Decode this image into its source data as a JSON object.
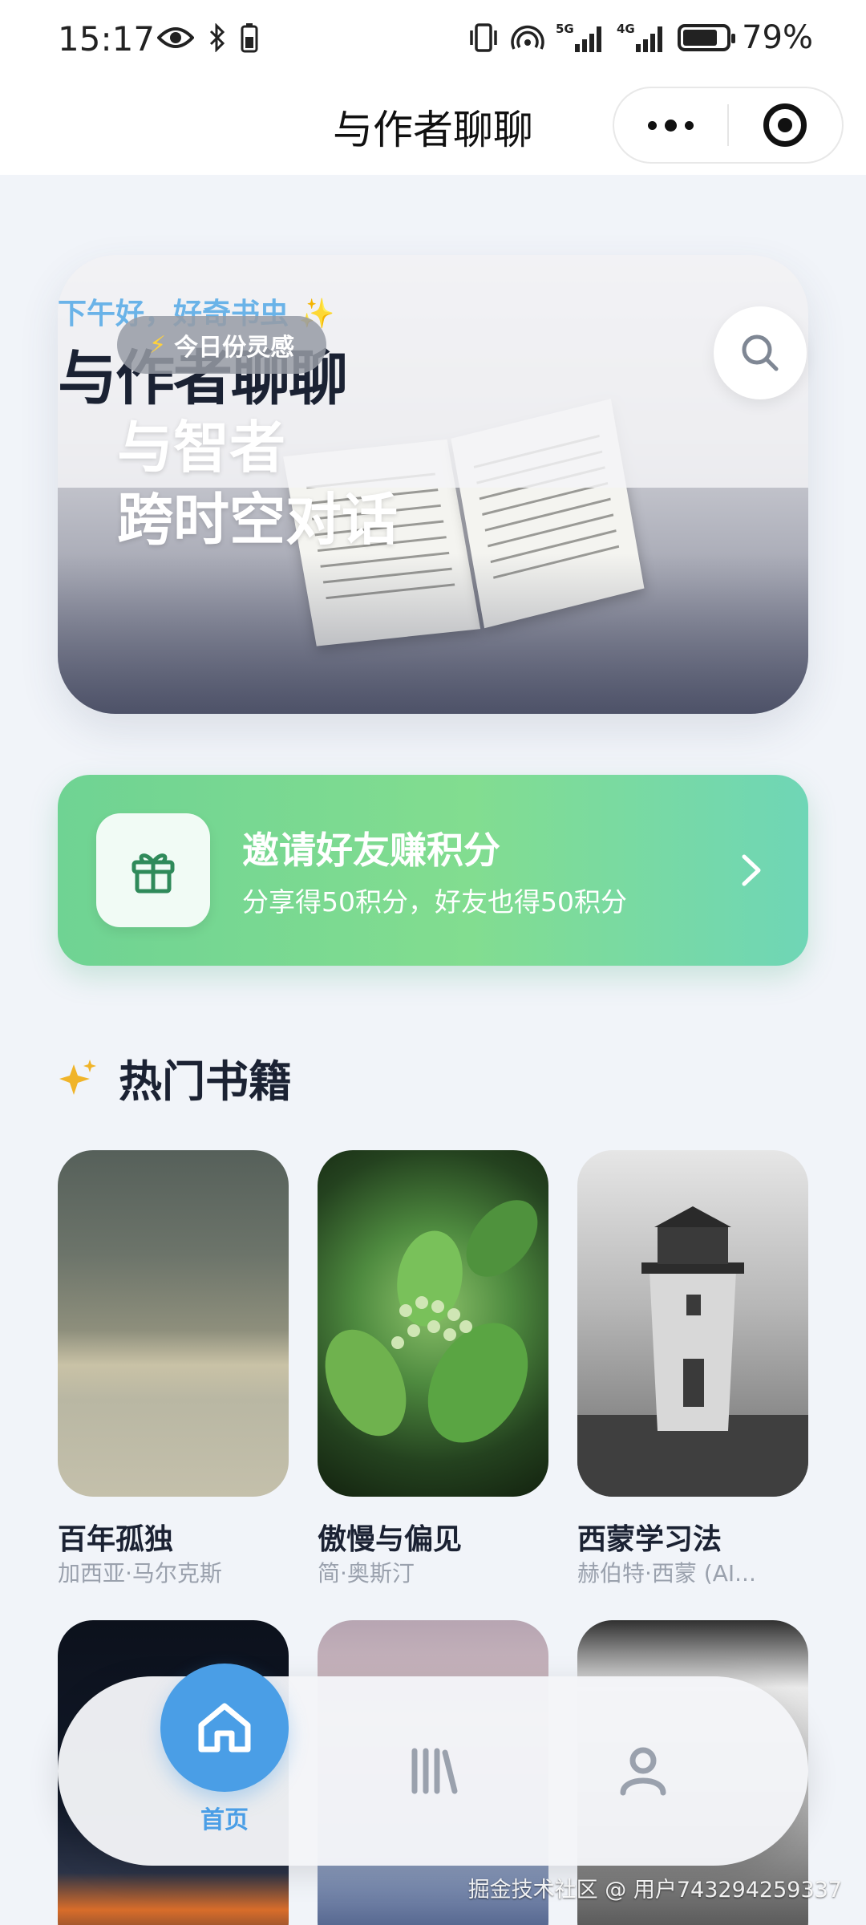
{
  "status_bar": {
    "time": "15:17",
    "battery_text": "79%",
    "signal_1": "5G",
    "signal_2": "4G",
    "hotspot_count": "1"
  },
  "header": {
    "title": "与作者聊聊"
  },
  "hero": {
    "greeting": "下午好，好奇书虫 ✨",
    "app_title": "与作者聊聊",
    "pill_label": "今日份灵感",
    "line_1": "与智者",
    "line_2": "跨时空对话"
  },
  "invite": {
    "title": "邀请好友赚积分",
    "subtitle": "分享得50积分，好友也得50积分"
  },
  "popular": {
    "section_title": "热门书籍",
    "books": [
      {
        "title": "百年孤独",
        "author": "加西亚·马尔克斯"
      },
      {
        "title": "傲慢与偏见",
        "author": "简·奥斯汀"
      },
      {
        "title": "西蒙学习法",
        "author": "赫伯特·西蒙 (AI..."
      }
    ]
  },
  "tabbar": {
    "home_label": "首页",
    "active_color": "#4a9ee6"
  },
  "watermark": "掘金技术社区 @ 用户743294259337",
  "colors": {
    "accent": "#4a9ee6",
    "invite_green": "#7fdc90",
    "greeting_blue": "#6ab3e8"
  }
}
